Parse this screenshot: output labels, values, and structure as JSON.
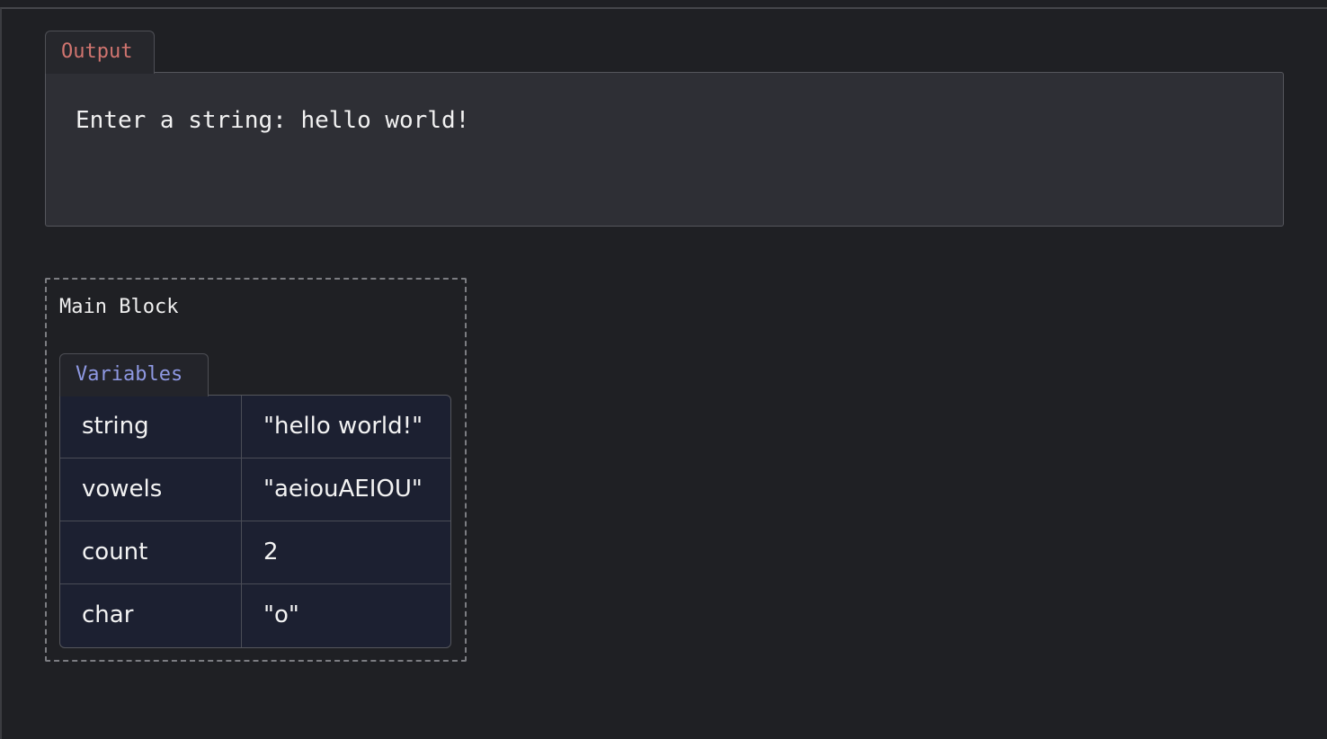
{
  "output": {
    "tab_label": "Output",
    "text": "Enter a string: hello world!"
  },
  "main_block": {
    "title": "Main Block",
    "variables_tab_label": "Variables",
    "variables": [
      {
        "name": "string",
        "value": "\"hello world!\""
      },
      {
        "name": "vowels",
        "value": "\"aeiouAEIOU\""
      },
      {
        "name": "count",
        "value": "2"
      },
      {
        "name": "char",
        "value": "\"o\""
      }
    ]
  },
  "colors": {
    "background": "#1f2024",
    "output_tab_text": "#d0746f",
    "variables_tab_text": "#8e98e2",
    "table_background": "#1c2031"
  }
}
